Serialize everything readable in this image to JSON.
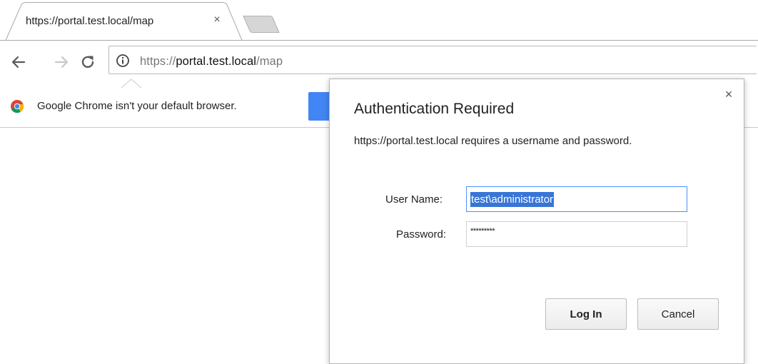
{
  "tab": {
    "title": "https://portal.test.local/map",
    "close_glyph": "×"
  },
  "toolbar": {
    "back_icon": "back-arrow-icon",
    "forward_icon": "forward-arrow-icon",
    "reload_icon": "reload-icon",
    "url": {
      "scheme": "https://",
      "host": "portal.test.local",
      "path": "/map"
    },
    "info_icon": "info-icon"
  },
  "infobar": {
    "message": "Google Chrome isn't your default browser.",
    "icon": "chrome-logo-icon",
    "button_color": "#4285f4"
  },
  "auth_dialog": {
    "title": "Authentication Required",
    "message": "https://portal.test.local requires a username and password.",
    "close_glyph": "×",
    "username_label": "User Name:",
    "username_value": "test\\administrator",
    "password_label": "Password:",
    "password_mask": "*********",
    "login_label": "Log In",
    "cancel_label": "Cancel",
    "focus_color": "#4d90fe",
    "selection_color": "#3875d7"
  }
}
